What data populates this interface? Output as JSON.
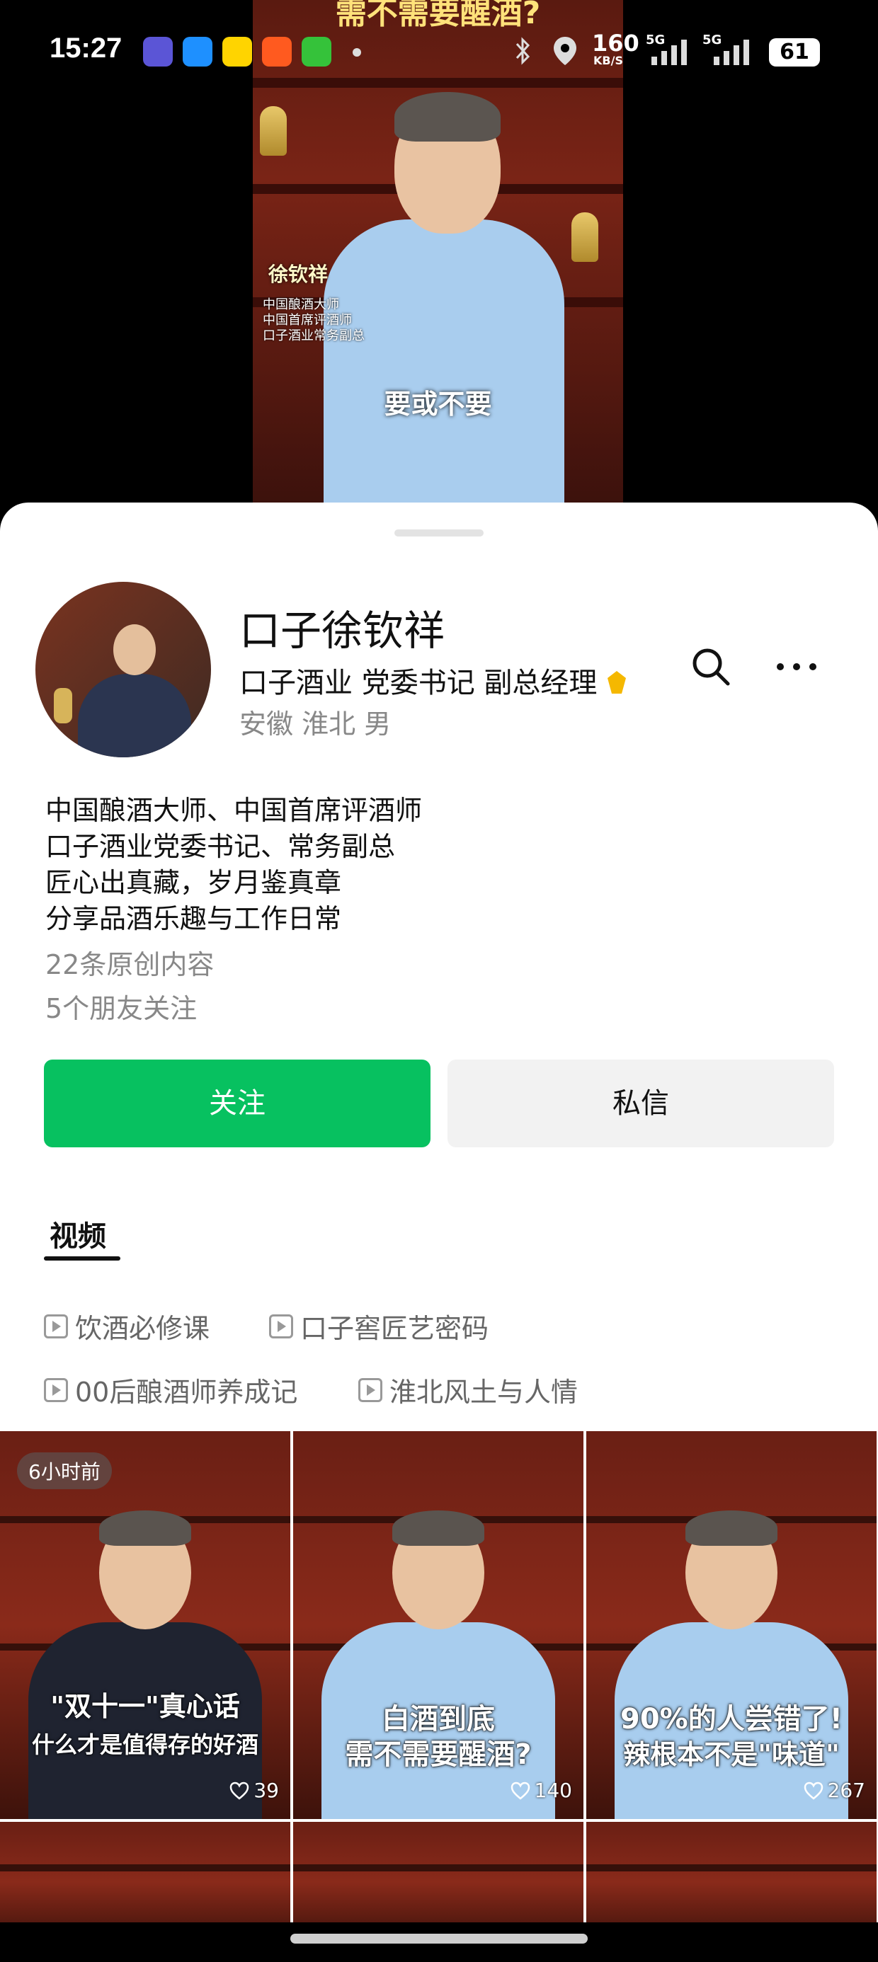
{
  "status_bar": {
    "time": "15:27",
    "network_speed": "160",
    "network_speed_unit": "KB/S",
    "signal_1": "5G",
    "signal_2": "5G",
    "battery": "61",
    "icons": [
      "bluetooth-icon",
      "location-icon"
    ]
  },
  "video": {
    "title_overlay": "需不需要醒酒?",
    "name_overlay": "徐钦祥",
    "tag_lines": [
      "中国酿酒大师",
      "中国首席评酒师",
      "口子酒业常务副总"
    ],
    "subtitle": "要或不要"
  },
  "profile": {
    "name": "口子徐钦祥",
    "title": "口子酒业 党委书记  副总经理",
    "location": "安徽 淮北 男",
    "bio": [
      "中国酿酒大师、中国首席评酒师",
      "口子酒业党委书记、常务副总",
      "匠心出真藏，岁月鉴真章",
      "分享品酒乐趣与工作日常"
    ],
    "original_count": "22条原创内容",
    "friends_follow": "5个朋友关注",
    "follow_label": "关注",
    "message_label": "私信"
  },
  "tabs": {
    "active": "视频"
  },
  "collections": [
    "饮酒必修课",
    "口子窖匠艺密码",
    "00后酿酒师养成记",
    "淮北风土与人情"
  ],
  "videos": [
    {
      "badge": "6小时前",
      "caption_1": "\"双十一\"真心话",
      "caption_2": "什么才是值得存的好酒",
      "likes": "39"
    },
    {
      "badge": "",
      "caption_1": "白酒到底",
      "caption_2": "需不需要醒酒?",
      "likes": "140"
    },
    {
      "badge": "",
      "caption_1": "90%的人尝错了!",
      "caption_2": "辣根本不是\"味道\"",
      "likes": "267"
    }
  ],
  "colors": {
    "follow_green": "#07c160",
    "message_gray": "#f2f2f2",
    "secondary_text": "#888888"
  }
}
